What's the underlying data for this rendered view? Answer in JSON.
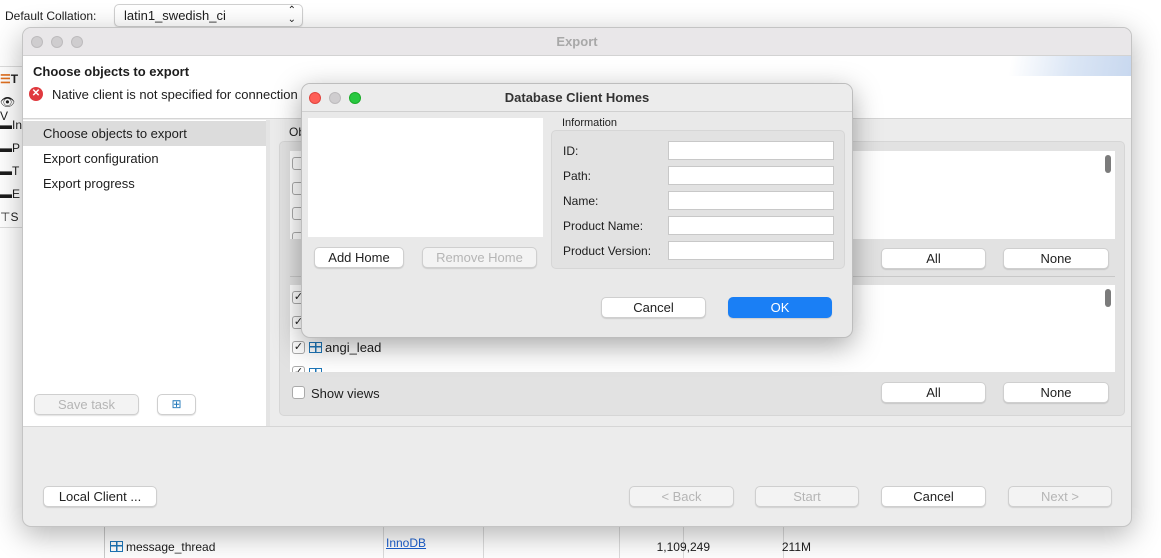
{
  "background": {
    "collation_label": "Default Collation:",
    "collation_value": "latin1_swedish_ci",
    "sidebar_fragments": [
      "T",
      "V",
      "In",
      "P",
      "T",
      "E",
      "S"
    ],
    "table_row": {
      "name": "message_thread",
      "engine": "InnoDB",
      "rows": "1,109,249",
      "size": "211M"
    }
  },
  "export": {
    "title": "Export",
    "header_title": "Choose objects to export",
    "error_message": "Native client is not specified for connection",
    "nav": [
      {
        "label": "Choose objects to export",
        "selected": true
      },
      {
        "label": "Export configuration"
      },
      {
        "label": "Export progress"
      }
    ],
    "objects_label": "Ob",
    "upper_all": "All",
    "upper_none": "None",
    "lower_items": [
      {
        "label": "",
        "checked": true
      },
      {
        "label": "",
        "checked": true
      },
      {
        "label": "angi_lead",
        "checked": true
      },
      {
        "label": "",
        "checked": true
      }
    ],
    "show_views_label": "Show views",
    "show_views_checked": false,
    "lower_all": "All",
    "lower_none": "None",
    "save_task": "Save task",
    "local_client": "Local Client ...",
    "back": "< Back",
    "start": "Start",
    "cancel": "Cancel",
    "next": "Next >"
  },
  "dialog": {
    "title": "Database Client Homes",
    "add_home": "Add Home",
    "remove_home": "Remove Home",
    "info_label": "Information",
    "fields": [
      {
        "label": "ID:",
        "value": ""
      },
      {
        "label": "Path:",
        "value": ""
      },
      {
        "label": "Name:",
        "value": ""
      },
      {
        "label": "Product Name:",
        "value": ""
      },
      {
        "label": "Product Version:",
        "value": ""
      }
    ],
    "cancel": "Cancel",
    "ok": "OK"
  },
  "colors": {
    "accent": "#1a7ff5",
    "error": "#e0393e",
    "link": "#1a5fd0"
  }
}
